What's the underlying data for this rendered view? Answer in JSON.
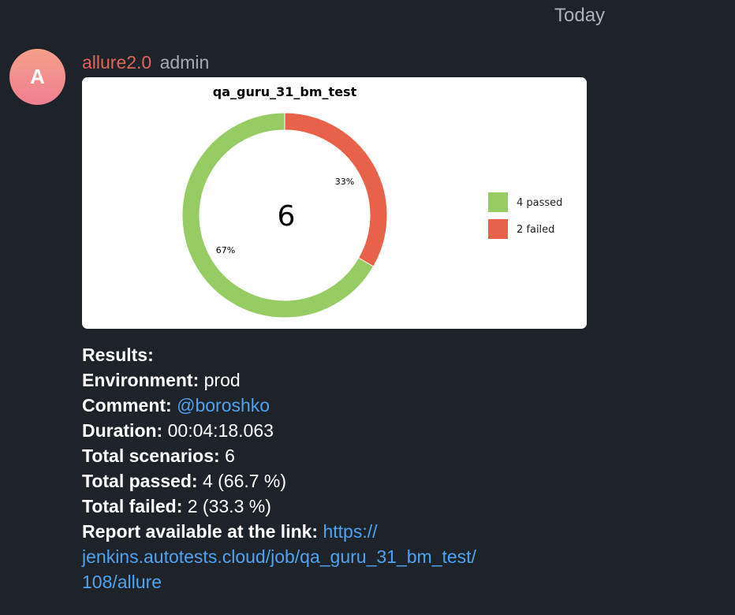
{
  "date_label": "Today",
  "avatar": {
    "letter": "A",
    "colors": [
      "#f5a08a",
      "#ef7f92"
    ]
  },
  "message": {
    "sender": "allure2.0",
    "role": "admin"
  },
  "chart_data": {
    "type": "pie",
    "title": "qa_guru_31_bm_test",
    "center_label": "6",
    "slices": [
      {
        "label": "4 passed",
        "value": 4,
        "percent_label": "67%",
        "color": "#97cc64"
      },
      {
        "label": "2 failed",
        "value": 2,
        "percent_label": "33%",
        "color": "#e8624a"
      }
    ],
    "legend_position": "right"
  },
  "results": {
    "heading": "Results:",
    "environment_label": "Environment:",
    "environment_value": "prod",
    "comment_label": "Comment:",
    "comment_value": "@boroshko",
    "duration_label": "Duration:",
    "duration_value": "00:04:18.063",
    "total_scenarios_label": "Total scenarios:",
    "total_scenarios_value": "6",
    "total_passed_label": "Total passed:",
    "total_passed_value": "4 (66.7 %)",
    "total_failed_label": "Total failed:",
    "total_failed_value": "2 (33.3 %)",
    "report_label": "Report available at the link:",
    "report_link_part1": "https://",
    "report_link_part2": "jenkins.autotests.cloud/job/qa_guru_31_bm_test/",
    "report_link_part3": "108/allure"
  },
  "colors": {
    "background": "#1e2229",
    "sender": "#e0655a",
    "link": "#4fa3f0",
    "passed": "#97cc64",
    "failed": "#e8624a"
  }
}
